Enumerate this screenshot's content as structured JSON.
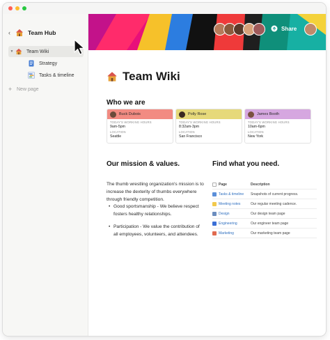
{
  "sidebar": {
    "back_label": "‹",
    "title": "Team Hub",
    "items": [
      {
        "label": "Team Wiki",
        "icon": "house-icon",
        "expanded": true,
        "active": true
      },
      {
        "label": "Strategy",
        "icon": "document-icon"
      },
      {
        "label": "Tasks & timeline",
        "icon": "timeline-icon"
      }
    ],
    "new_page_label": "New page"
  },
  "header": {
    "share_label": "Share"
  },
  "page": {
    "title": "Team Wiki",
    "who_heading": "Who we are",
    "people": [
      {
        "name": "Buck Dubois",
        "hours_label": "TODAY'S WORKING HOURS",
        "hours": "9am-5pm",
        "location_label": "LOCATION",
        "location": "Seattle",
        "color": "#f28b82"
      },
      {
        "name": "Polly Rose",
        "hours_label": "TODAY'S WORKING HOURS",
        "hours": "8:32am-3pm",
        "location_label": "LOCATION",
        "location": "San Francisco",
        "color": "#e6d97a"
      },
      {
        "name": "James Booth",
        "hours_label": "TODAY'S WORKING HOURS",
        "hours": "10am-6pm",
        "location_label": "LOCATION",
        "location": "New York",
        "color": "#d6a7e0"
      }
    ],
    "mission_heading": "Our mission & values.",
    "mission_text": "The thumb wrestling organization's mission is to increase the dexterity of thumbs everywhere through friendly competition.",
    "values": [
      "Good sportsmanship - We believe respect fosters healthy relationships.",
      "Participation - We value the contribution of all employees, volunteers, and attendees."
    ],
    "find_heading": "Find what you need.",
    "table": {
      "headers": [
        "Page",
        "Description"
      ],
      "rows": [
        {
          "page": "Tasks & timeline",
          "description": "Snapshots of current progress.",
          "icon_color": "#5b8fd9"
        },
        {
          "page": "Meeting notes",
          "description": "Our regular meeting cadence.",
          "icon_color": "#f2c94c"
        },
        {
          "page": "Design",
          "description": "Our design team page",
          "icon_color": "#6c8ebf"
        },
        {
          "page": "Engineering",
          "description": "Our engineer team page",
          "icon_color": "#3b6fd6"
        },
        {
          "page": "Marketing",
          "description": "Our marketing team page",
          "icon_color": "#e06a4f"
        }
      ]
    }
  }
}
